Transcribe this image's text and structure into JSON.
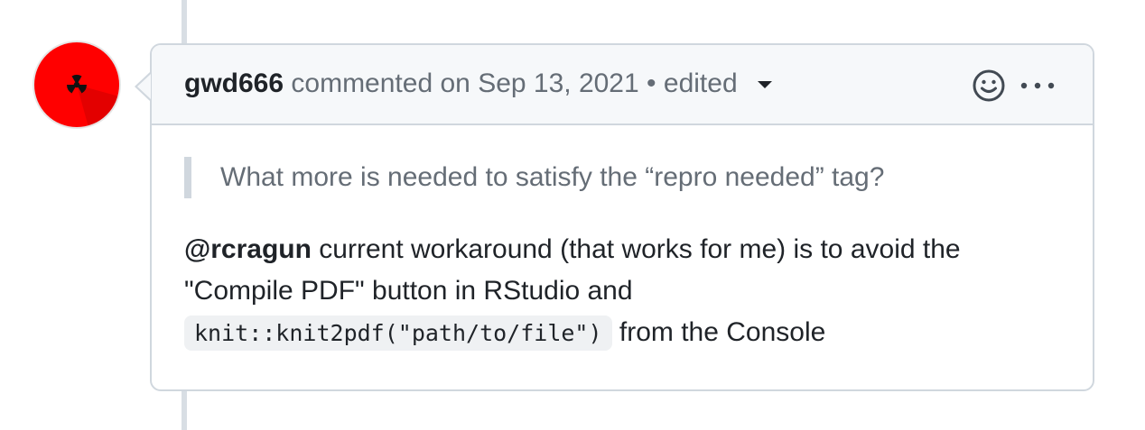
{
  "comment": {
    "author": "gwd666",
    "action_text": "commented on",
    "date": "Sep 13, 2021",
    "separator": "•",
    "edited_label": "edited",
    "quote": "What more is needed to satisfy the “repro needed” tag?",
    "mention": "@rcragun",
    "text_1": " current workaround (that works for me) is to avoid the \"Compile PDF\" button in RStudio and",
    "code": "knit::knit2pdf(\"path/to/file\")",
    "text_2": " from the Console"
  },
  "icons": {
    "avatar": "radiation-symbol-icon",
    "reaction": "smiley-icon",
    "menu": "kebab-horizontal-icon"
  },
  "colors": {
    "avatar_bg": "#ff0000",
    "header_bg": "#f6f8fa",
    "border": "#d0d7de",
    "muted_text": "#656d76",
    "code_bg": "#eff1f3"
  }
}
